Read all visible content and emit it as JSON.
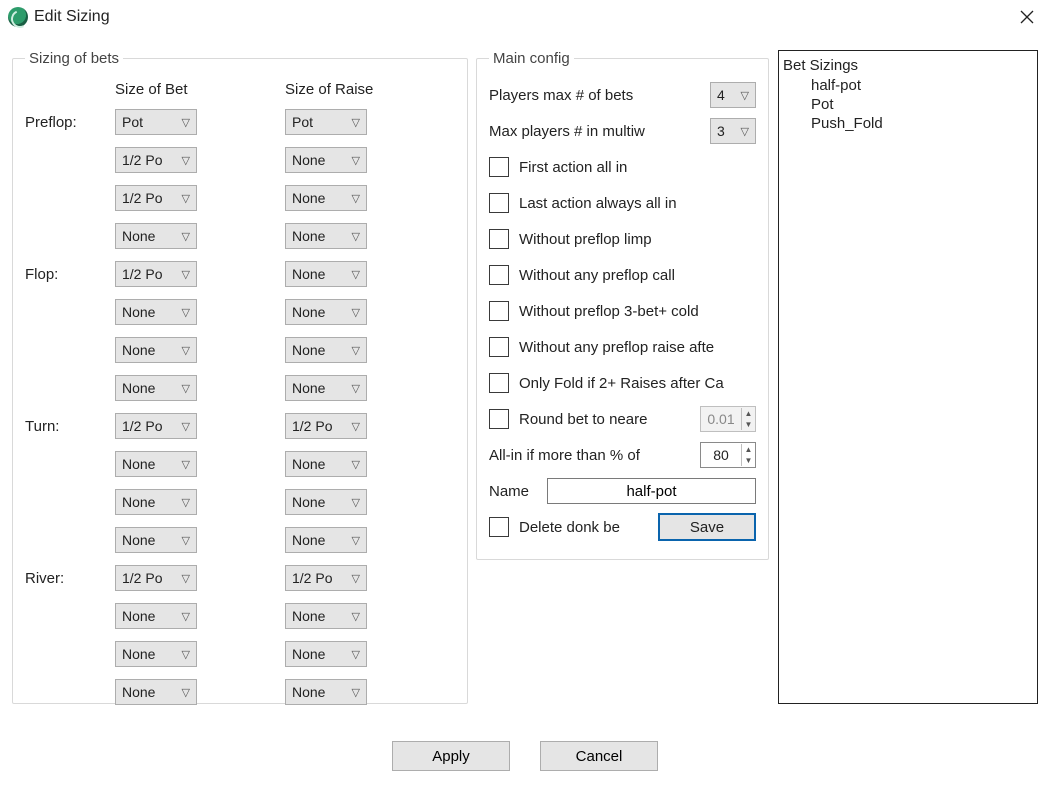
{
  "window": {
    "title": "Edit Sizing"
  },
  "sizing": {
    "legend": "Sizing of bets",
    "header_bet": "Size of Bet",
    "header_raise": "Size of Raise",
    "streets": [
      {
        "name": "Preflop:",
        "bets": [
          "Pot",
          "1/2 Po",
          "1/2 Po",
          "None"
        ],
        "raises": [
          "Pot",
          "None",
          "None",
          "None"
        ]
      },
      {
        "name": "Flop:",
        "bets": [
          "1/2 Po",
          "None",
          "None",
          "None"
        ],
        "raises": [
          "None",
          "None",
          "None",
          "None"
        ]
      },
      {
        "name": "Turn:",
        "bets": [
          "1/2 Po",
          "None",
          "None",
          "None"
        ],
        "raises": [
          "1/2 Po",
          "None",
          "None",
          "None"
        ]
      },
      {
        "name": "River:",
        "bets": [
          "1/2 Po",
          "None",
          "None",
          "None"
        ],
        "raises": [
          "1/2 Po",
          "None",
          "None",
          "None"
        ]
      }
    ]
  },
  "main": {
    "legend": "Main config",
    "players_max_bets_label": "Players max # of bets",
    "players_max_bets_value": "4",
    "max_multiway_label": "Max players # in multiw",
    "max_multiway_value": "3",
    "checks": [
      "First action all in",
      "Last action always all in",
      "Without preflop limp",
      "Without any preflop call",
      "Without preflop 3-bet+ cold",
      "Without any preflop raise afte",
      "Only Fold if 2+ Raises after Ca"
    ],
    "round_label": "Round bet to neare",
    "round_value": "0.01",
    "allin_label": "All-in if more than % of",
    "allin_value": "80",
    "name_label": "Name",
    "name_value": "half-pot",
    "delete_donk_label": "Delete donk be",
    "save_label": "Save"
  },
  "list": {
    "header": "Bet Sizings",
    "items": [
      "half-pot",
      "Pot",
      "Push_Fold"
    ]
  },
  "footer": {
    "apply": "Apply",
    "cancel": "Cancel"
  }
}
